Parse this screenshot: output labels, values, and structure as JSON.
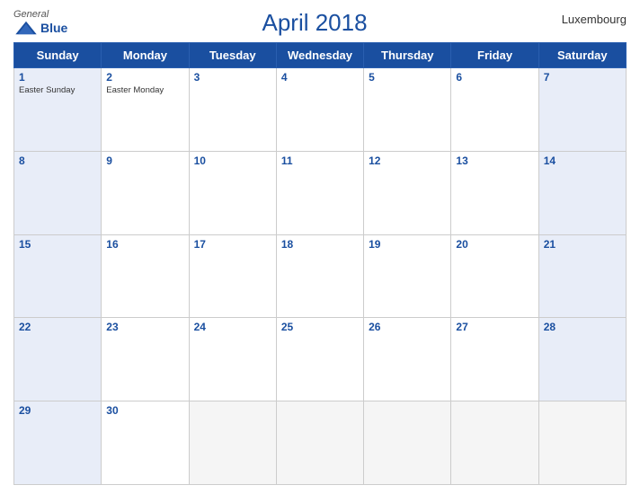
{
  "header": {
    "logo_general": "General",
    "logo_blue": "Blue",
    "title": "April 2018",
    "country": "Luxembourg"
  },
  "weekdays": [
    "Sunday",
    "Monday",
    "Tuesday",
    "Wednesday",
    "Thursday",
    "Friday",
    "Saturday"
  ],
  "weeks": [
    [
      {
        "day": "1",
        "holiday": "Easter Sunday",
        "type": "sunday"
      },
      {
        "day": "2",
        "holiday": "Easter Monday",
        "type": "weekday"
      },
      {
        "day": "3",
        "holiday": "",
        "type": "weekday"
      },
      {
        "day": "4",
        "holiday": "",
        "type": "weekday"
      },
      {
        "day": "5",
        "holiday": "",
        "type": "weekday"
      },
      {
        "day": "6",
        "holiday": "",
        "type": "weekday"
      },
      {
        "day": "7",
        "holiday": "",
        "type": "saturday"
      }
    ],
    [
      {
        "day": "8",
        "holiday": "",
        "type": "sunday"
      },
      {
        "day": "9",
        "holiday": "",
        "type": "weekday"
      },
      {
        "day": "10",
        "holiday": "",
        "type": "weekday"
      },
      {
        "day": "11",
        "holiday": "",
        "type": "weekday"
      },
      {
        "day": "12",
        "holiday": "",
        "type": "weekday"
      },
      {
        "day": "13",
        "holiday": "",
        "type": "weekday"
      },
      {
        "day": "14",
        "holiday": "",
        "type": "saturday"
      }
    ],
    [
      {
        "day": "15",
        "holiday": "",
        "type": "sunday"
      },
      {
        "day": "16",
        "holiday": "",
        "type": "weekday"
      },
      {
        "day": "17",
        "holiday": "",
        "type": "weekday"
      },
      {
        "day": "18",
        "holiday": "",
        "type": "weekday"
      },
      {
        "day": "19",
        "holiday": "",
        "type": "weekday"
      },
      {
        "day": "20",
        "holiday": "",
        "type": "weekday"
      },
      {
        "day": "21",
        "holiday": "",
        "type": "saturday"
      }
    ],
    [
      {
        "day": "22",
        "holiday": "",
        "type": "sunday"
      },
      {
        "day": "23",
        "holiday": "",
        "type": "weekday"
      },
      {
        "day": "24",
        "holiday": "",
        "type": "weekday"
      },
      {
        "day": "25",
        "holiday": "",
        "type": "weekday"
      },
      {
        "day": "26",
        "holiday": "",
        "type": "weekday"
      },
      {
        "day": "27",
        "holiday": "",
        "type": "weekday"
      },
      {
        "day": "28",
        "holiday": "",
        "type": "saturday"
      }
    ],
    [
      {
        "day": "29",
        "holiday": "",
        "type": "sunday"
      },
      {
        "day": "30",
        "holiday": "",
        "type": "weekday"
      },
      {
        "day": "",
        "holiday": "",
        "type": "empty"
      },
      {
        "day": "",
        "holiday": "",
        "type": "empty"
      },
      {
        "day": "",
        "holiday": "",
        "type": "empty"
      },
      {
        "day": "",
        "holiday": "",
        "type": "empty"
      },
      {
        "day": "",
        "holiday": "",
        "type": "empty"
      }
    ]
  ]
}
